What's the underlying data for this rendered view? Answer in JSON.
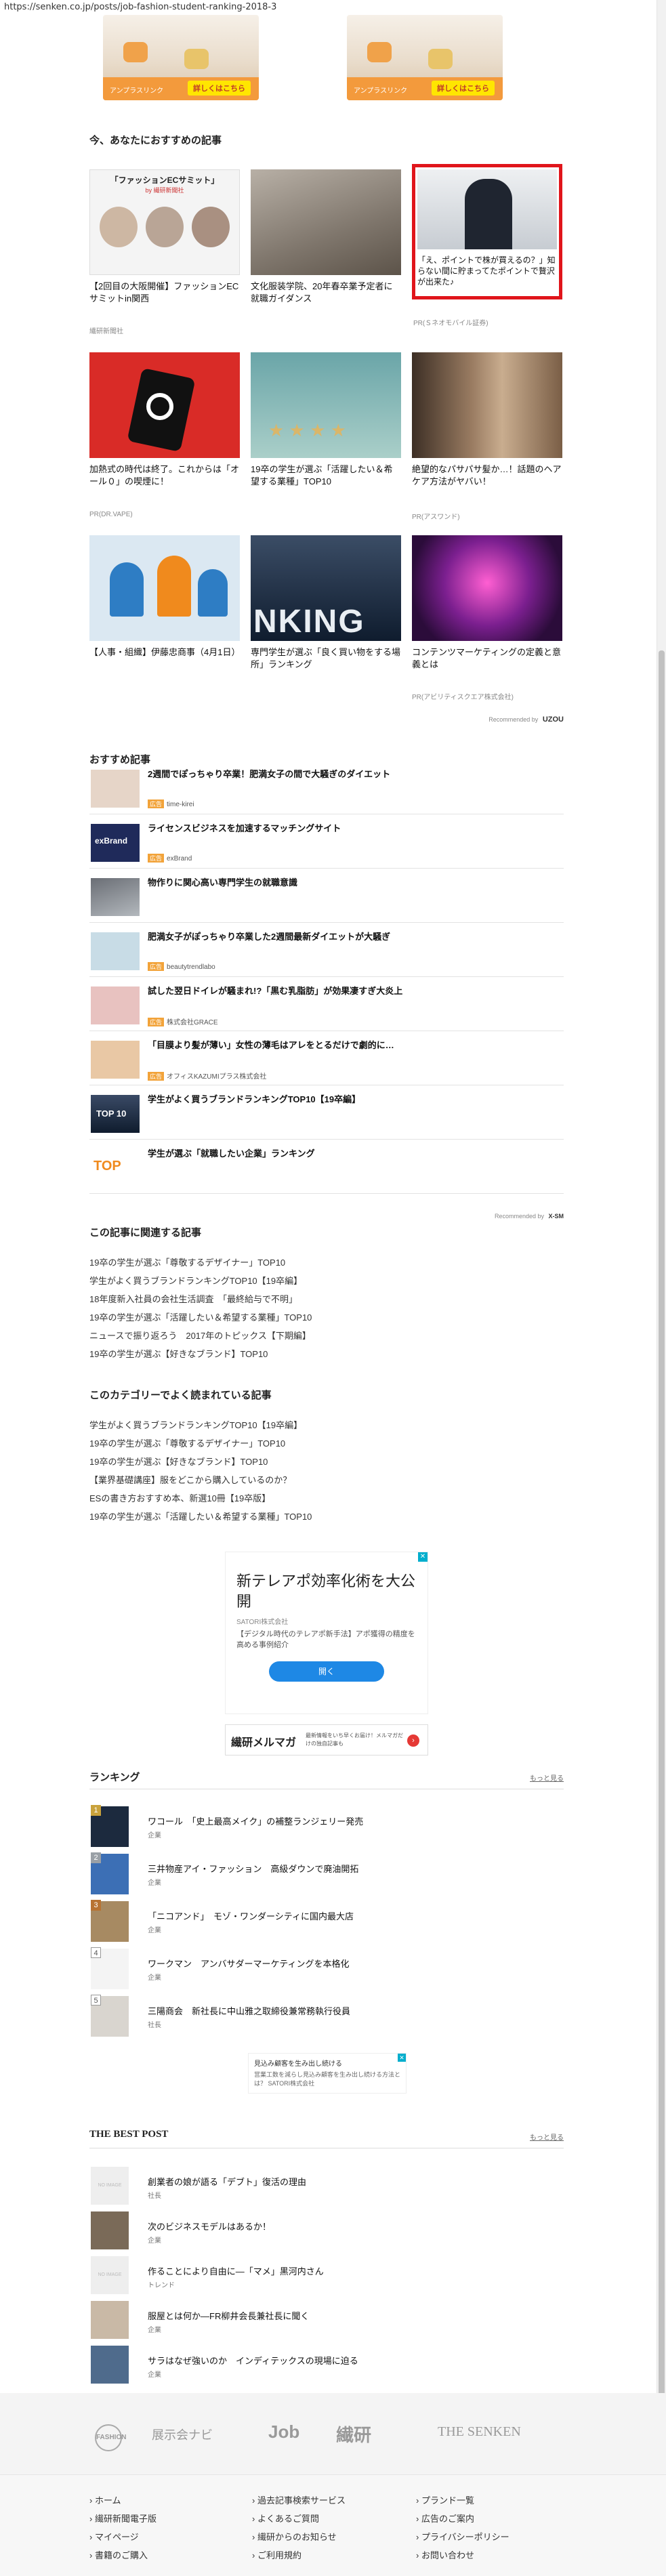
{
  "url": "https://senken.co.jp/posts/job-fashion-student-ranking-2018-3",
  "banners": [
    {
      "label": "アンプラスリンク",
      "cta": "詳しくはこちら"
    },
    {
      "label": "アンプラスリンク",
      "cta": "詳しくはこちら"
    }
  ],
  "recommend_title": "今、あなたにおすすめの記事",
  "cards": [
    {
      "title": "【2回目の大阪開催】ファッションECサミットin関西",
      "source": "繊研新聞社",
      "thumb_text": "「ファッションECサミット」",
      "thumb_sub": "by 繊研新聞社"
    },
    {
      "title": "文化服装学院、20年春卒業予定者に就職ガイダンス",
      "source": ""
    },
    {
      "title": "「え、ポイントで株が買えるの？」知らない間に貯まってたポイントで贅沢が出来た♪",
      "source": "PR(Ｓネオモバイル証券)"
    },
    {
      "title": "加熱式の時代は終了。これからは「オール０」の喫煙に！",
      "source": "PR(DR.VAPE)"
    },
    {
      "title": "19卒の学生が選ぶ「活躍したい＆希望する業種」TOP10",
      "source": ""
    },
    {
      "title": "絶望的なパサパサ髪か…！話題のヘアケア方法がヤバい！",
      "source": "PR(アスワンド)"
    },
    {
      "title": "【人事・組織】伊藤忠商事（4月1日）",
      "source": ""
    },
    {
      "title": "専門学生が選ぶ「良く買い物をする場所」ランキング",
      "source": ""
    },
    {
      "title": "コンテンツマーケティングの定義と意義とは",
      "source": "PR(アビリティスクエア株式会社)"
    }
  ],
  "recommended_by": "Recommended by",
  "uzou": "UZOU",
  "osusume_title": "おすすめ記事",
  "osusume": [
    {
      "title": "2週間でぽっちゃり卒業！肥満女子の間で大騒ぎのダイエット",
      "sponsor": "time-kirei"
    },
    {
      "title": "ライセンスビジネスを加速するマッチングサイト",
      "sponsor": "exBrand"
    },
    {
      "title": "物作りに関心高い専門学生の就職意識",
      "sponsor": ""
    },
    {
      "title": "肥満女子がぽっちゃり卒業した2週間最新ダイエットが大騒ぎ",
      "sponsor": "beautytrendlabo"
    },
    {
      "title": "試した翌日ドイレが騒まれ!?「黒む乳脂肪」が効果凄すぎ大炎上",
      "sponsor": "株式会社GRACE"
    },
    {
      "title": "「目膜より髪が薄い」女性の薄毛はアレをとるだけで劇的に…",
      "sponsor": "オフィスKAZUMIプラス株式会社"
    },
    {
      "title": "学生がよく買うブランドランキングTOP10【19卒編】",
      "sponsor": ""
    },
    {
      "title": "学生が選ぶ「就職したい企業」ランキング",
      "sponsor": ""
    }
  ],
  "sponsor_badge": "広告",
  "recommended_xsm": "Recommended by",
  "xsm": "X-SM",
  "related_title": "この記事に関連する記事",
  "related": [
    "19卒の学生が選ぶ「尊敬するデザイナー」TOP10",
    "学生がよく買うブランドランキングTOP10【19卒編】",
    "18年度新入社員の会社生活調査　「最終給与で不明」",
    "19卒の学生が選ぶ「活躍したい＆希望する業種」TOP10",
    "ニュースで振り返ろう　2017年のトピックス【下期編】",
    "19卒の学生が選ぶ【好きなブランド】TOP10"
  ],
  "category_title": "このカテゴリーでよく読まれている記事",
  "category": [
    "学生がよく買うブランドランキングTOP10【19卒編】",
    "19卒の学生が選ぶ「尊敬するデザイナー」TOP10",
    "19卒の学生が選ぶ【好きなブランド】TOP10",
    "【業界基礎講座】服をどこから購入しているのか？",
    "ESの書き方おすすめ本、新選10冊【19卒版】",
    "19卒の学生が選ぶ「活躍したい＆希望する業種」TOP10"
  ],
  "ad1": {
    "title": "新テレアポ効率化術を大公開",
    "company": "SATORI株式会社",
    "body": "【デジタル時代のテレアポ新手法】アポ獲得の精度を高める事例紹介",
    "button": "開く"
  },
  "ad2": {
    "brand": "繊研メルマガ",
    "text": "最新情報をいち早くお届け！メルマガだけの独自記事も"
  },
  "ranking_title": "ランキング",
  "more": "もっと見る",
  "ranking": [
    {
      "n": "1",
      "title": "ワコール　「史上最高メイク」の補整ランジェリー発売",
      "cat": "企業"
    },
    {
      "n": "2",
      "title": "三井物産アイ・ファッション　高級ダウンで廃油開拓",
      "cat": "企業"
    },
    {
      "n": "3",
      "title": "「ニコアンド」　モゾ・ワンダーシティに国内最大店",
      "cat": "企業"
    },
    {
      "n": "4",
      "title": "ワークマン　アンバサダーマーケティングを本格化",
      "cat": "企業"
    },
    {
      "n": "5",
      "title": "三陽商会　新社長に中山雅之取締役兼常務執行役員",
      "cat": "社長"
    }
  ],
  "ad3": {
    "text1": "見込み顧客を生み出し続ける",
    "text2": "営業工数を減らし見込み顧客を生み出し続ける方法とは？ SATORI株式会社"
  },
  "best_title": "THE BEST POST",
  "best": [
    {
      "title": "創業者の娘が語る「デブト」復活の理由",
      "cat": "社長"
    },
    {
      "title": "次のビジネスモデルはあるか！",
      "cat": "企業"
    },
    {
      "title": "作ることにより自由に―「マメ」黒河内さん",
      "cat": "トレンド"
    },
    {
      "title": "服屋とは何か―FR柳井会長兼社長に聞く",
      "cat": "企業"
    },
    {
      "title": "サラはなぜ強いのか　インディテックスの現場に迫る",
      "cat": "企業"
    }
  ],
  "noimage": "NO IMAGE",
  "footer_logos": [
    "FASHION",
    "展示会ナビ",
    "Job",
    "繊研",
    "THE SENKEN"
  ],
  "footer_cols": [
    [
      "ホーム",
      "繊研新聞電子版",
      "マイページ",
      "書籍のご購入"
    ],
    [
      "過去記事検索サービス",
      "よくあるご質問",
      "繊研からのお知らせ",
      "ご利用規約"
    ],
    [
      "プランド一覧",
      "広告のご案内",
      "プライバシーポリシー",
      "お問い合わせ"
    ]
  ]
}
